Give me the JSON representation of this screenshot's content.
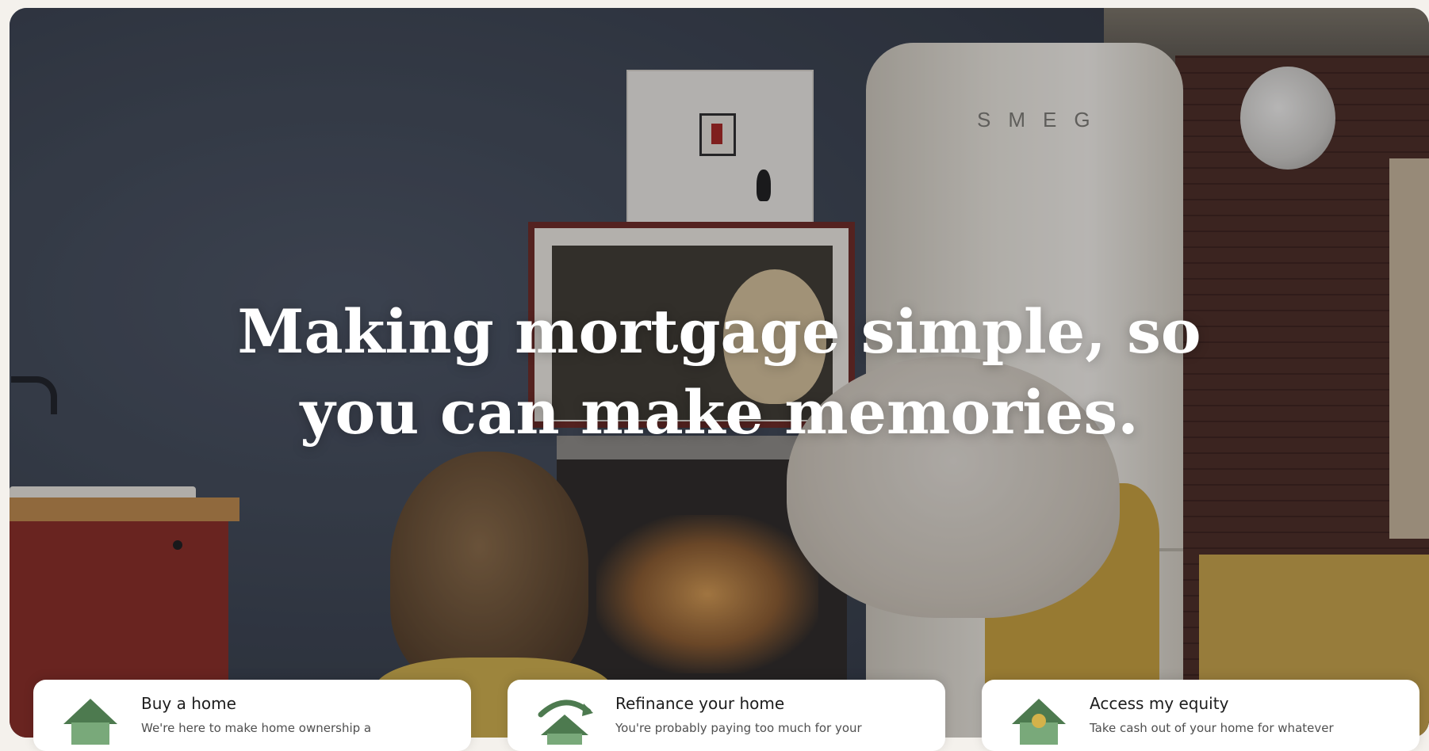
{
  "hero": {
    "headline_line1": "Making mortgage simple, so",
    "headline_line2": "you can make memories.",
    "photo_brand_text": "SMEG"
  },
  "cards": [
    {
      "icon": "house-icon",
      "title": "Buy a home",
      "description": "We're here to make home ownership a"
    },
    {
      "icon": "refinance-house-arrow-icon",
      "title": "Refinance your home",
      "description": "You're probably paying too much for your"
    },
    {
      "icon": "house-dollar-icon",
      "title": "Access my equity",
      "description": "Take cash out of your home for whatever"
    }
  ],
  "colors": {
    "icon_green": "#4d7a4f",
    "icon_light_green": "#79a97a",
    "headline": "#ffffff",
    "card_bg": "#ffffff"
  }
}
